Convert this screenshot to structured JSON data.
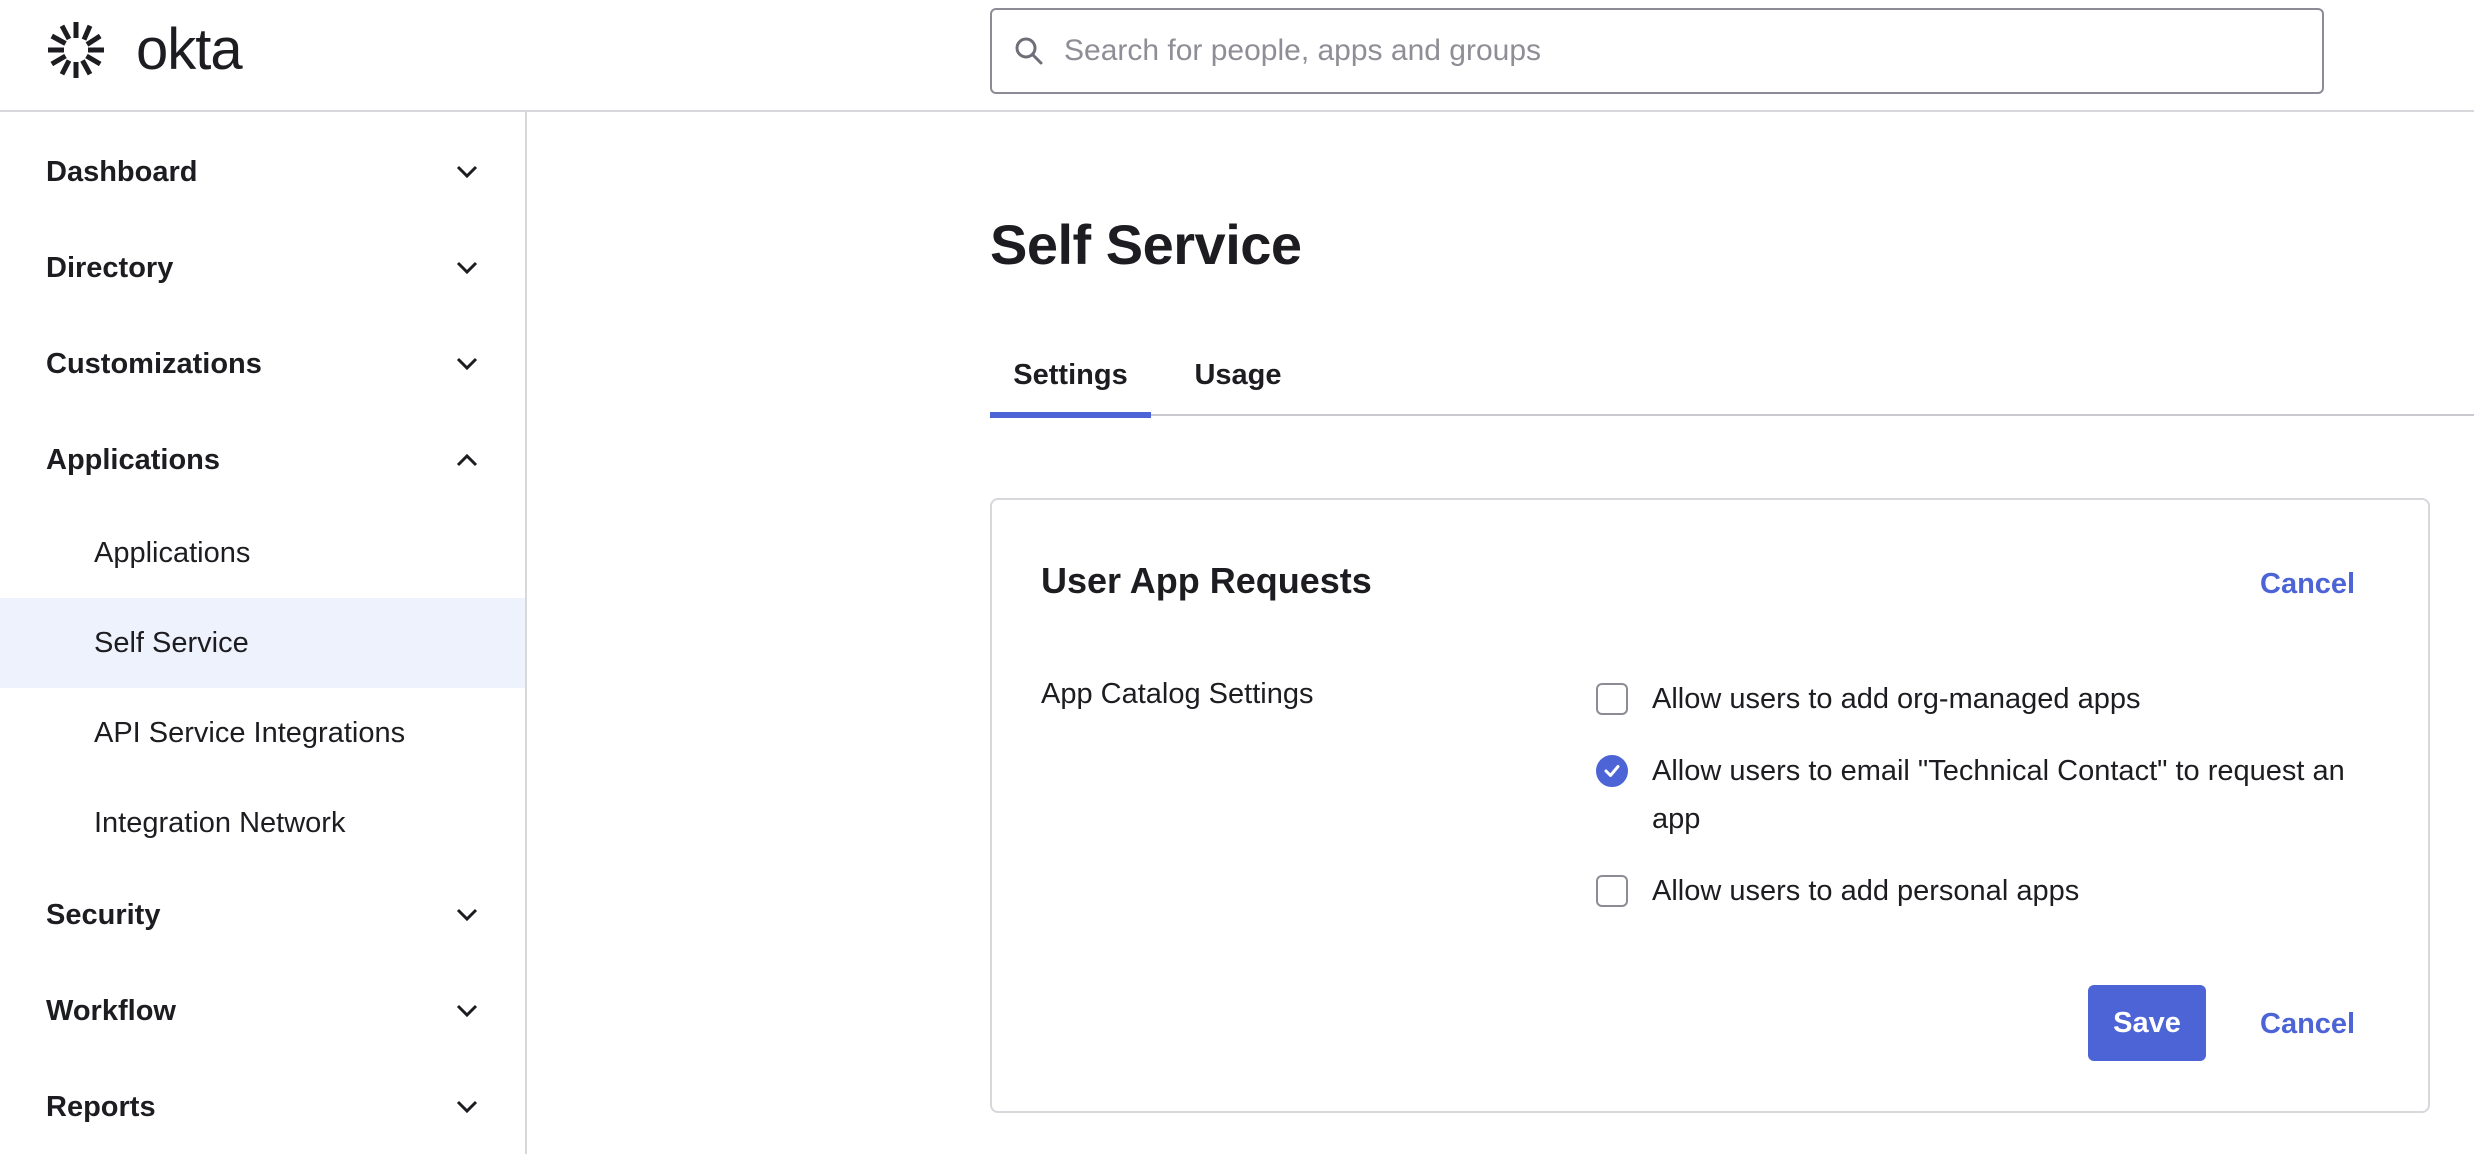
{
  "brand": {
    "name": "okta",
    "accent": "#4c64d6"
  },
  "search": {
    "placeholder": "Search for people, apps and groups"
  },
  "sidebar": {
    "sections": [
      {
        "label": "Dashboard",
        "expanded": false
      },
      {
        "label": "Directory",
        "expanded": false
      },
      {
        "label": "Customizations",
        "expanded": false
      },
      {
        "label": "Applications",
        "expanded": true,
        "items": [
          {
            "label": "Applications",
            "active": false
          },
          {
            "label": "Self Service",
            "active": true
          },
          {
            "label": "API Service Integrations",
            "active": false
          },
          {
            "label": "Integration Network",
            "active": false
          }
        ]
      },
      {
        "label": "Security",
        "expanded": false
      },
      {
        "label": "Workflow",
        "expanded": false
      },
      {
        "label": "Reports",
        "expanded": false
      }
    ]
  },
  "main": {
    "title": "Self Service",
    "tabs": [
      {
        "label": "Settings",
        "active": true
      },
      {
        "label": "Usage",
        "active": false
      }
    ],
    "card": {
      "title": "User App Requests",
      "cancel_label": "Cancel",
      "field_label": "App Catalog Settings",
      "options": [
        {
          "label": "Allow users to add org-managed apps",
          "checked": false
        },
        {
          "label": "Allow users to email \"Technical Contact\" to request an app",
          "checked": true
        },
        {
          "label": "Allow users to add personal apps",
          "checked": false
        }
      ],
      "save_label": "Save",
      "footer_cancel_label": "Cancel"
    }
  }
}
